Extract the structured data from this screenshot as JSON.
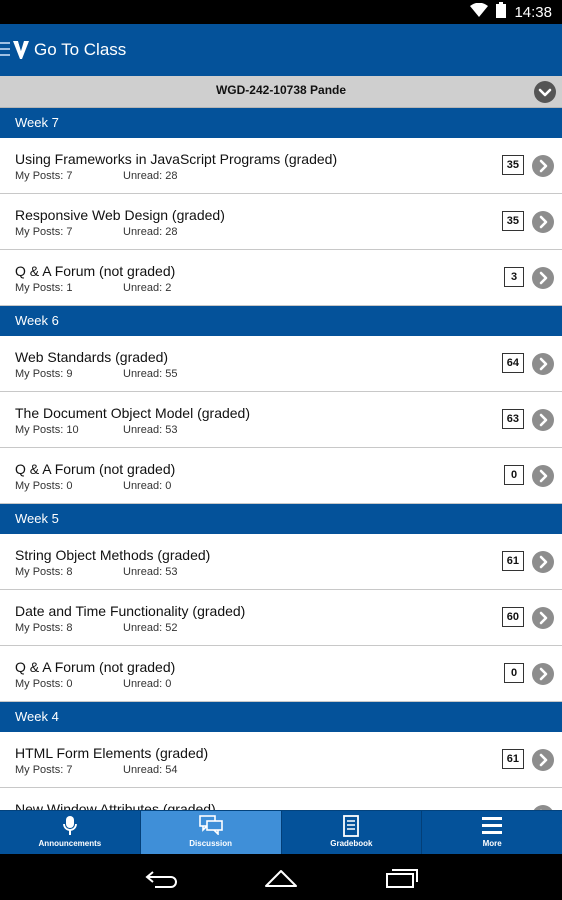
{
  "status_bar": {
    "time": "14:38",
    "wifi_icon": "wifi-icon",
    "battery_icon": "battery-icon"
  },
  "app_bar": {
    "title": "Go To Class",
    "menu_icon": "menu-icon",
    "logo_icon": "university-logo-icon"
  },
  "course": {
    "name": "WGD-242-10738 Pande",
    "dropdown_icon": "chevron-down-icon"
  },
  "labels": {
    "my_posts": "My Posts:",
    "unread": "Unread:"
  },
  "weeks": [
    {
      "label": "Week 7",
      "items": [
        {
          "title": "Using Frameworks in JavaScript Programs (graded)",
          "my_posts": "7",
          "unread": "28",
          "count": "35"
        },
        {
          "title": "Responsive Web Design (graded)",
          "my_posts": "7",
          "unread": "28",
          "count": "35"
        },
        {
          "title": "Q & A Forum (not graded)",
          "my_posts": "1",
          "unread": "2",
          "count": "3"
        }
      ]
    },
    {
      "label": "Week 6",
      "items": [
        {
          "title": "Web Standards (graded)",
          "my_posts": "9",
          "unread": "55",
          "count": "64"
        },
        {
          "title": "The Document Object Model (graded)",
          "my_posts": "10",
          "unread": "53",
          "count": "63"
        },
        {
          "title": "Q & A Forum (not graded)",
          "my_posts": "0",
          "unread": "0",
          "count": "0"
        }
      ]
    },
    {
      "label": "Week 5",
      "items": [
        {
          "title": "String Object Methods (graded)",
          "my_posts": "8",
          "unread": "53",
          "count": "61"
        },
        {
          "title": "Date and Time Functionality (graded)",
          "my_posts": "8",
          "unread": "52",
          "count": "60"
        },
        {
          "title": "Q & A Forum (not graded)",
          "my_posts": "0",
          "unread": "0",
          "count": "0"
        }
      ]
    },
    {
      "label": "Week 4",
      "items": [
        {
          "title": "HTML Form Elements (graded)",
          "my_posts": "7",
          "unread": "54",
          "count": "61"
        },
        {
          "title": "New Window Attributes (graded)",
          "my_posts": "",
          "unread": "",
          "count": ""
        }
      ]
    }
  ],
  "tabs": [
    {
      "label": "Announcements",
      "icon": "microphone-icon",
      "active": false
    },
    {
      "label": "Discussion",
      "icon": "chat-bubbles-icon",
      "active": true
    },
    {
      "label": "Gradebook",
      "icon": "document-icon",
      "active": false
    },
    {
      "label": "More",
      "icon": "hamburger-icon",
      "active": false
    }
  ],
  "colors": {
    "primary": "#04529a",
    "active_tab": "#3f8fd8",
    "course_bar": "#cfcfcf"
  }
}
